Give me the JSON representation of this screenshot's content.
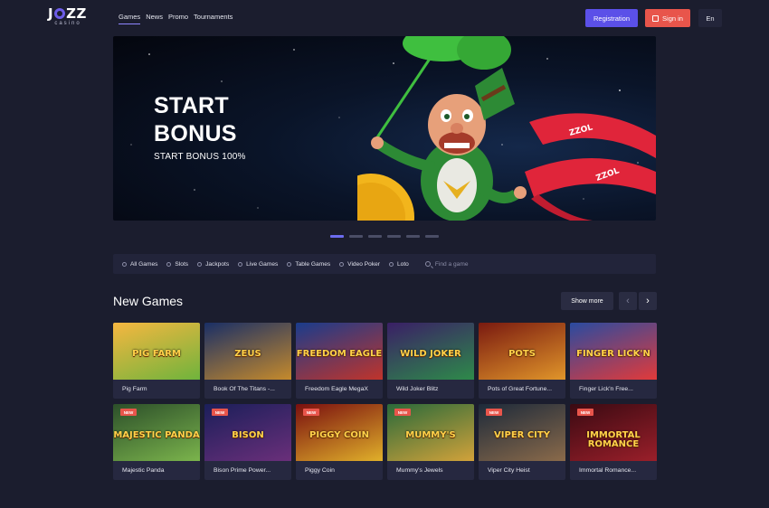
{
  "header": {
    "logo_main": "J  ZZ",
    "logo_sub": "casino",
    "nav": [
      {
        "label": "Games",
        "active": true
      },
      {
        "label": "News",
        "active": false
      },
      {
        "label": "Promo",
        "active": false
      },
      {
        "label": "Tournaments",
        "active": false
      }
    ],
    "registration_label": "Registration",
    "sign_in_label": "Sign in",
    "language": "En"
  },
  "banner": {
    "title_line1": "START",
    "title_line2": "BONUS",
    "subtitle": "START BONUS 100%",
    "slides_count": 6,
    "active_slide": 1
  },
  "categories": [
    {
      "label": "All Games",
      "icon": "grid-icon"
    },
    {
      "label": "Slots",
      "icon": "slot-icon"
    },
    {
      "label": "Jackpots",
      "icon": "jackpot-icon"
    },
    {
      "label": "Live Games",
      "icon": "live-icon"
    },
    {
      "label": "Table Games",
      "icon": "table-icon"
    },
    {
      "label": "Video Poker",
      "icon": "poker-icon"
    },
    {
      "label": "Loto",
      "icon": "loto-icon"
    }
  ],
  "search": {
    "placeholder": "Find a game"
  },
  "new_games": {
    "title": "New Games",
    "show_more": "Show more",
    "games": [
      {
        "name": "Pig Farm",
        "thumb_text": "PIG FARM",
        "new": false,
        "colors": [
          "#f6b640",
          "#6fb43c"
        ]
      },
      {
        "name": "Book Of The Titans -...",
        "thumb_text": "ZEUS",
        "new": false,
        "colors": [
          "#1a2f66",
          "#c58a2c"
        ]
      },
      {
        "name": "Freedom Eagle MegaX",
        "thumb_text": "FREEDOM EAGLE",
        "new": false,
        "colors": [
          "#1a3c8c",
          "#c0342b"
        ]
      },
      {
        "name": "Wild Joker Blitz",
        "thumb_text": "WILD JOKER",
        "new": false,
        "colors": [
          "#3a1f66",
          "#2e8a4a"
        ]
      },
      {
        "name": "Pots of Great Fortune...",
        "thumb_text": "POTS",
        "new": false,
        "colors": [
          "#7a1a10",
          "#e0952a"
        ]
      },
      {
        "name": "Finger Lick'n Free...",
        "thumb_text": "FINGER LICK'N",
        "new": false,
        "colors": [
          "#2a4ba0",
          "#e23a3a"
        ]
      },
      {
        "name": "Majestic Panda",
        "thumb_text": "MAJESTIC PANDA",
        "new": true,
        "colors": [
          "#2c4f2a",
          "#7bb44c"
        ]
      },
      {
        "name": "Bison Prime Power...",
        "thumb_text": "BISON",
        "new": true,
        "colors": [
          "#1b1f5a",
          "#6a2f7a"
        ]
      },
      {
        "name": "Piggy Coin",
        "thumb_text": "PIGGY COIN",
        "new": true,
        "colors": [
          "#7a0f0f",
          "#e0b02a"
        ]
      },
      {
        "name": "Mummy's Jewels",
        "thumb_text": "MUMMY'S",
        "new": true,
        "colors": [
          "#2a6a3a",
          "#d2a23a"
        ]
      },
      {
        "name": "Viper City Heist",
        "thumb_text": "VIPER CITY",
        "new": true,
        "colors": [
          "#1d2a3a",
          "#8a6a4a"
        ]
      },
      {
        "name": "Immortal Romance...",
        "thumb_text": "IMMORTAL ROMANCE",
        "new": true,
        "colors": [
          "#3a0a12",
          "#9a1f2a"
        ]
      }
    ],
    "new_badge": "NEW"
  },
  "colors": {
    "background": "#1b1d2e",
    "accent_purple": "#5b50e8",
    "accent_red": "#e8554b"
  }
}
